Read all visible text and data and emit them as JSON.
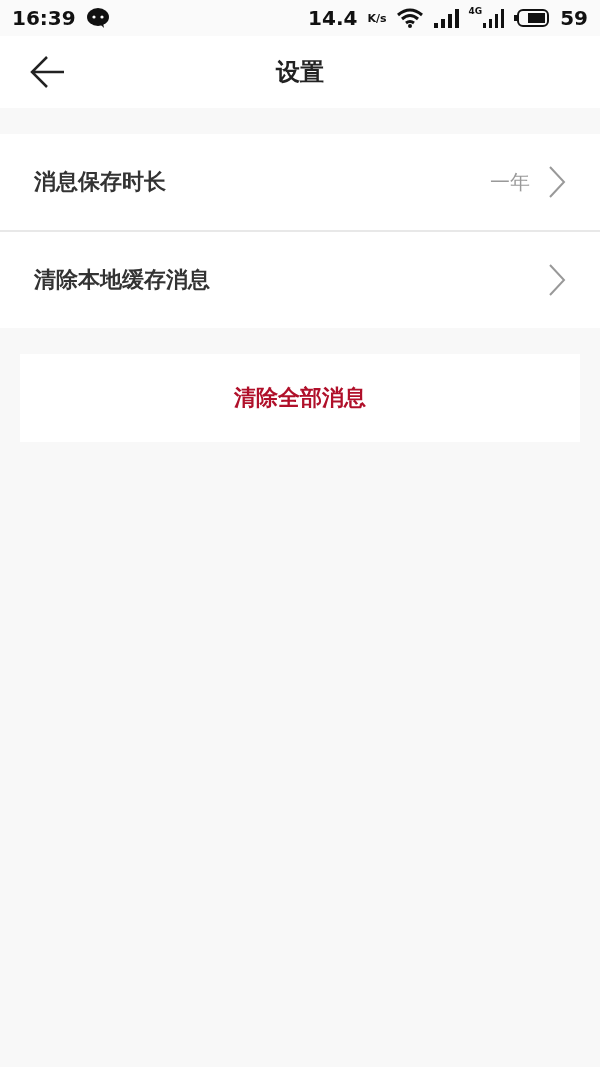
{
  "status_bar": {
    "time": "16:39",
    "speed": "14.4",
    "speed_unit": "K/s",
    "network_label": "4G",
    "battery": "59"
  },
  "header": {
    "title": "设置"
  },
  "rows": [
    {
      "label": "消息保存时长",
      "value": "一年"
    },
    {
      "label": "清除本地缓存消息"
    }
  ],
  "action": {
    "label": "清除全部消息"
  }
}
